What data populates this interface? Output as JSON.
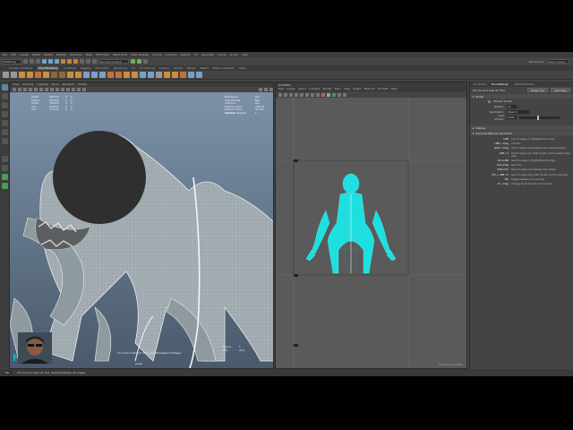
{
  "menubar": [
    "File",
    "Edit",
    "Create",
    "Select",
    "Modify",
    "Display",
    "Windows",
    "Mesh",
    "Edit Mesh",
    "Mesh Tools",
    "Mesh Display",
    "Curves",
    "Surfaces",
    "Deform",
    "UV",
    "Generate",
    "Cache",
    "Arnold",
    "Help"
  ],
  "statusline": {
    "mode": "Modeling",
    "no_live_surface": "No Live Surface",
    "workspace_label": "Workspace:",
    "workspace": "Maya Classic"
  },
  "shelf_tabs": [
    "Curves / Surfaces",
    "Poly Modeling",
    "Sculpting",
    "Rigging",
    "Animation",
    "Rendering",
    "FX",
    "FX Caching",
    "Custom",
    "Arnold",
    "Bifrost",
    "MASH",
    "Motion Graphics",
    "XGen"
  ],
  "shelf_active_tab": "Poly Modeling",
  "viewport": {
    "menu": [
      "View",
      "Shading",
      "Lighting",
      "Show",
      "Renderer",
      "Panels"
    ],
    "hud_left": [
      {
        "label": "Verts:",
        "c1": "325276",
        "c2": "0",
        "c3": "0"
      },
      {
        "label": "Edges:",
        "c1": "650184",
        "c2": "0",
        "c3": "0"
      },
      {
        "label": "Faces:",
        "c1": "324928",
        "c2": "0",
        "c3": "0"
      },
      {
        "label": "Tris:",
        "c1": "649856",
        "c2": "0",
        "c3": "0"
      },
      {
        "label": "UVs:",
        "c1": "371534",
        "c2": "0",
        "c3": "0"
      }
    ],
    "hud_right": [
      {
        "label": "Backfaces:",
        "value": "N/A"
      },
      {
        "label": "Smoothness:",
        "value": "N/A"
      },
      {
        "label": "Instance:",
        "value": "N/A"
      },
      {
        "label": "Display Layer:",
        "value": "default"
      },
      {
        "label": "Distance From Camera:",
        "value": "94.402"
      },
      {
        "label": "Selected Objects:",
        "value": "1"
      }
    ],
    "hud_bottom_left": "UV Cut and Sew UV Tool: Select/Cut/Sew UV Edges",
    "hud_bottom_right": [
      {
        "label": "Frame:",
        "value": "1"
      },
      {
        "label": "FPS:",
        "value": "24.0"
      }
    ],
    "camera": "persp"
  },
  "uv_editor": {
    "title": "UV Editor",
    "menu": [
      "Edit",
      "Create",
      "Select",
      "Cut/Sew",
      "Modify",
      "Tools",
      "View",
      "Image",
      "Textures",
      "UV Sets",
      "Help"
    ],
    "footer": "Normal 0-1 UV Editor"
  },
  "right_panel": {
    "tabs": [
      "UV Toolkit",
      "Tool Settings",
      "Attribute Editor"
    ],
    "active_tab": "Tool Settings",
    "tool_name": "UV Cut and Sew UV Tool",
    "reset_label": "Reset Tool",
    "help_label": "Tool Help",
    "sections": {
      "brush": "Brush",
      "display": "Display",
      "hotkeys": "Keyboard/Mouse Shortcuts"
    },
    "brush_opts": {
      "steady": "Steady Stroke",
      "radius_label": "Radius:",
      "radius_value": "10",
      "symmetry_label": "Symmetry:",
      "symmetry_value": "Object X",
      "lazy_label": "Lazy Stroke:",
      "lazy_value": "0.000"
    },
    "hotkeys": [
      {
        "key": "LMB",
        "desc": "Cut UV edges or highlighted UV edge"
      },
      {
        "key": "LMB + Drag",
        "desc": "Cut UVs"
      },
      {
        "key": "Shift + Drag",
        "desc": "Cut UV edge loop between two selected edges"
      },
      {
        "key": "LMB x 2",
        "desc": "Cut UV edge loop. Shift double click to select edge loop"
      },
      {
        "key": "Ctrl+LMB",
        "desc": "Sew UV edges or highlighted UV edge"
      },
      {
        "key": "Ctrl+Drag",
        "desc": "Sew UVs"
      },
      {
        "key": "Shift+Ctrl",
        "desc": "Sew UV edge loop between two edges"
      },
      {
        "key": "Ctrl + LMB x 2",
        "desc": "Sew UV edge loop. Shift double click to sew loop"
      },
      {
        "key": "Tab",
        "desc": "Toggle between cut and sew"
      },
      {
        "key": "B + Drag",
        "desc": "Change brush size for Cut and Sew"
      }
    ]
  },
  "bottombar": {
    "mel": "MEL",
    "status": "UV Cut and Sew UV Tool: Select/Cut/Sew UV edges"
  }
}
